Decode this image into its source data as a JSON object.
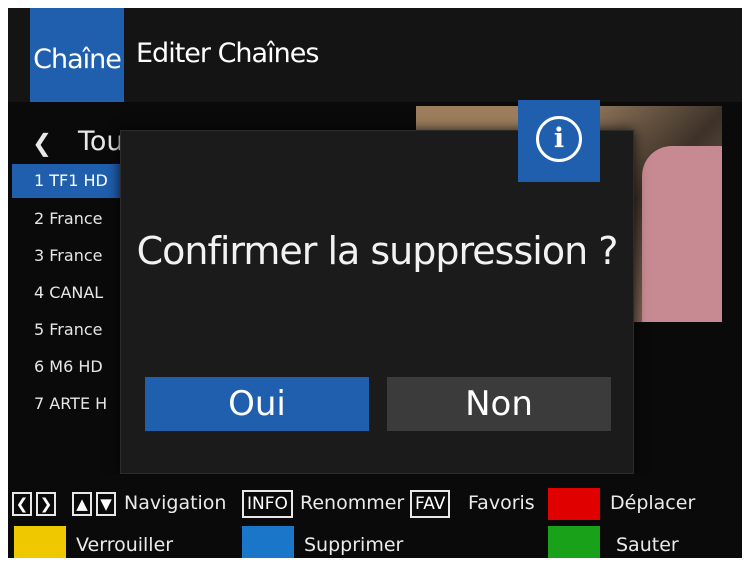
{
  "header": {
    "active_tab": "Chaîne",
    "tab_edit": "Editer Chaînes"
  },
  "list": {
    "group_title": "Tou",
    "items": [
      "1 TF1 HD",
      "2 France",
      "3 France",
      "4 CANAL",
      "5 France",
      "6 M6 HD",
      "7 ARTE H"
    ],
    "selected_index": 0
  },
  "dialog": {
    "icon": "info-icon",
    "message": "Confirmer la suppression ?",
    "confirm_label": "Oui",
    "cancel_label": "Non",
    "focused": "Oui"
  },
  "footer": {
    "nav_label": "Navigation",
    "info_key": "INFO",
    "info_label": "Renommer",
    "fav_key": "FAV",
    "fav_label": "Favoris",
    "red_label": "Déplacer",
    "yellow_label": "Verrouiller",
    "blue_label": "Supprimer",
    "green_label": "Sauter"
  },
  "colors": {
    "accent": "#1f5fae",
    "red": "#e00000",
    "yellow": "#f0c800",
    "blue": "#1a76c8",
    "green": "#1aa11a"
  }
}
